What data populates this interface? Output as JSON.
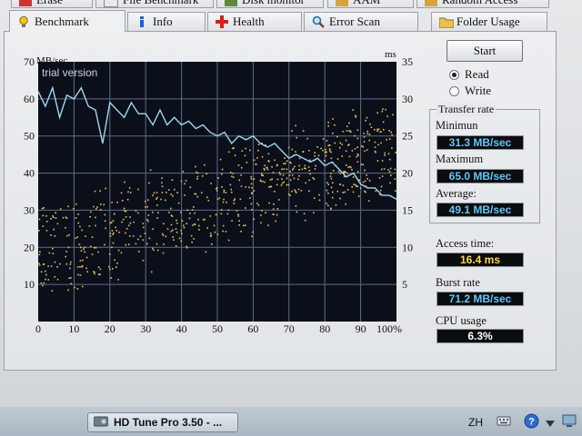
{
  "tabs_row1": [
    "Erase",
    "File Benchmark",
    "Disk monitor",
    "AAM",
    "Random Access"
  ],
  "tabs_row2": [
    "Benchmark",
    "Info",
    "Health",
    "Error Scan",
    "Folder Usage"
  ],
  "chart": {
    "y_left_unit": "MB/sec",
    "y_right_unit": "ms",
    "watermark": "trial version",
    "y_left_ticks": [
      "70",
      "60",
      "50",
      "40",
      "30",
      "20",
      "10"
    ],
    "y_right_ticks": [
      "35",
      "30",
      "25",
      "20",
      "15",
      "10",
      "5"
    ],
    "x_ticks": [
      "0",
      "10",
      "20",
      "30",
      "40",
      "50",
      "60",
      "70",
      "80",
      "90",
      "100%"
    ]
  },
  "chart_data": {
    "type": "line",
    "xlabel": "",
    "x_range": [
      0,
      100
    ],
    "y_left_range": [
      0,
      70
    ],
    "y_right_range": [
      0,
      35
    ],
    "grid": true,
    "series": [
      {
        "axis": "left",
        "x": [
          0,
          2,
          4,
          6,
          8,
          10,
          12,
          14,
          16,
          18,
          20,
          22,
          24,
          26,
          28,
          30,
          32,
          34,
          36,
          38,
          40,
          42,
          44,
          46,
          48,
          50,
          52,
          54,
          56,
          58,
          60,
          62,
          64,
          66,
          68,
          70,
          72,
          74,
          76,
          78,
          80,
          82,
          84,
          86,
          88,
          90,
          92,
          94,
          96,
          98,
          100
        ],
        "y": [
          62,
          58,
          63,
          55,
          61,
          60,
          63,
          58,
          57,
          48,
          59,
          57,
          55,
          59,
          56,
          56,
          53,
          57,
          53,
          55,
          53,
          54,
          52,
          53,
          51,
          50,
          51,
          48,
          50,
          49,
          50,
          48,
          47,
          48,
          46,
          44,
          45,
          44,
          43,
          44,
          42,
          43,
          41,
          39,
          40,
          37,
          36,
          36,
          34,
          34,
          33
        ]
      },
      {
        "axis": "right",
        "type": "scatter",
        "x_range": [
          0,
          100
        ],
        "y_range": [
          3,
          32
        ],
        "trend_start": [
          0,
          9
        ],
        "trend_end": [
          95,
          24
        ],
        "approx_points": 700
      }
    ],
    "line_color": "#9fd7ee",
    "scatter_color": "#e8c05a"
  },
  "controls": {
    "start_label": "Start",
    "read_label": "Read",
    "write_label": "Write",
    "mode_selected": "Read"
  },
  "transfer_rate": {
    "title": "Transfer rate",
    "minimum_label": "Minimun",
    "minimum_value": "31.3 MB/sec",
    "maximum_label": "Maximum",
    "maximum_value": "65.0 MB/sec",
    "average_label": "Average:",
    "average_value": "49.1 MB/sec"
  },
  "access_time": {
    "label": "Access time:",
    "value": "16.4 ms"
  },
  "burst_rate": {
    "label": "Burst rate",
    "value": "71.2 MB/sec"
  },
  "cpu_usage": {
    "label": "CPU usage",
    "value": "6.3%"
  },
  "taskbar": {
    "window_title": "HD Tune Pro 3.50 - ...",
    "lang": "ZH"
  },
  "colors": {
    "plot_bg": "#0b0f1a",
    "grid": "#5e6e86",
    "blue_text": "#5ec8ff",
    "yellow_text": "#ffd84a"
  }
}
